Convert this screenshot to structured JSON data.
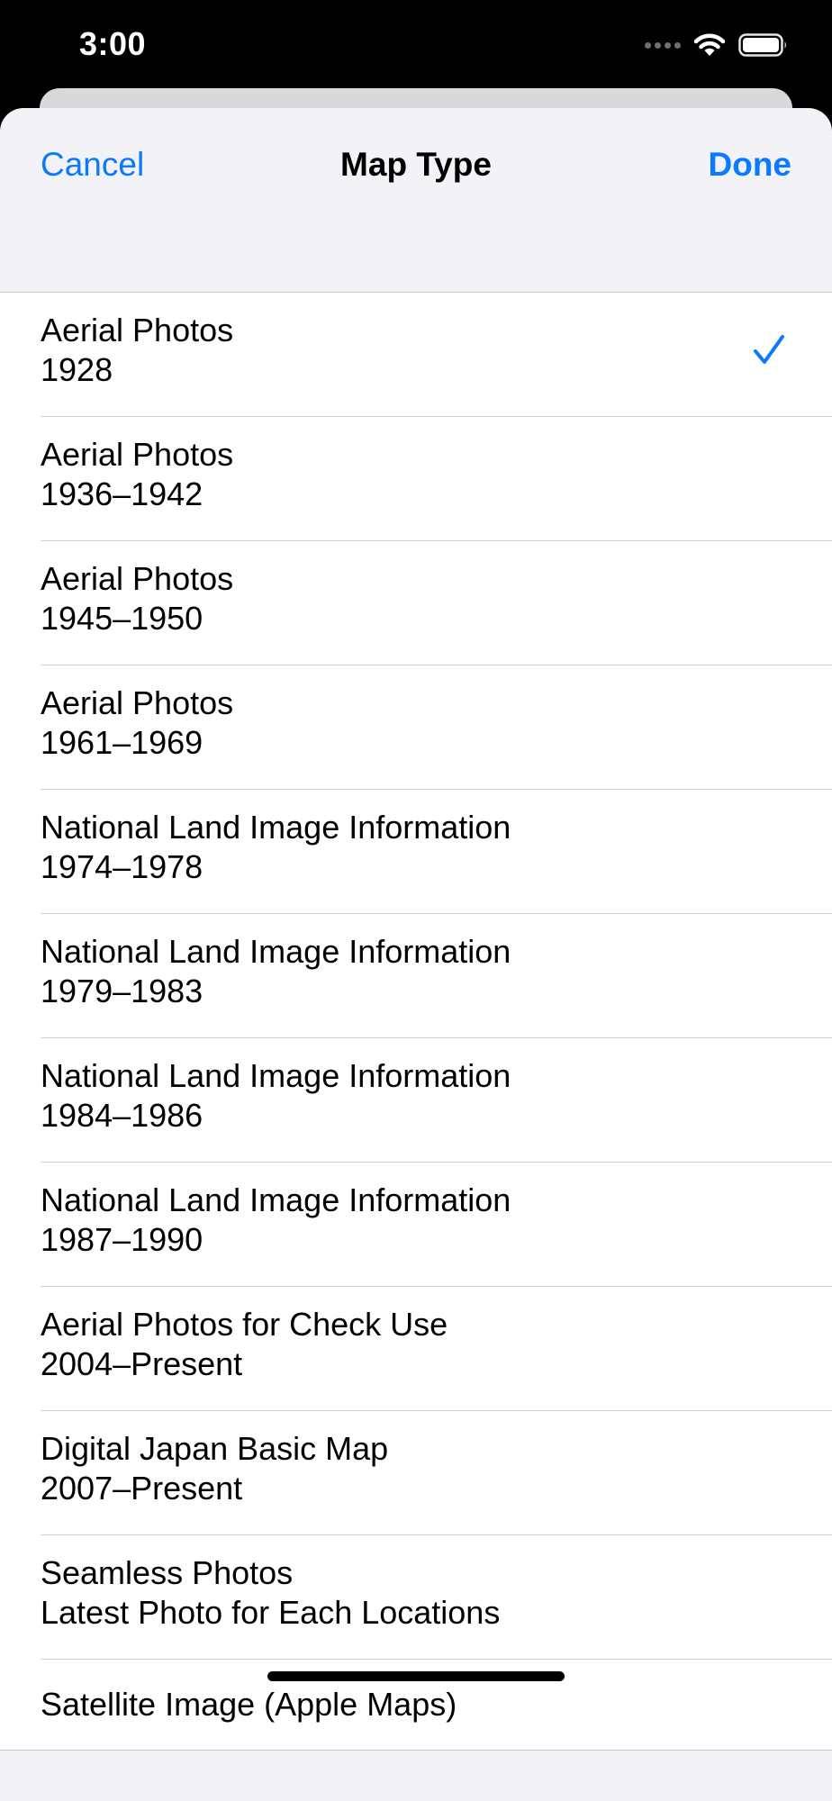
{
  "status_bar": {
    "time": "3:00"
  },
  "nav": {
    "cancel_label": "Cancel",
    "title": "Map Type",
    "done_label": "Done"
  },
  "accent_color": "#0a7aff",
  "items": [
    {
      "title": "Aerial Photos",
      "subtitle": "1928",
      "selected": true
    },
    {
      "title": "Aerial Photos",
      "subtitle": "1936–1942",
      "selected": false
    },
    {
      "title": "Aerial Photos",
      "subtitle": "1945–1950",
      "selected": false
    },
    {
      "title": "Aerial Photos",
      "subtitle": "1961–1969",
      "selected": false
    },
    {
      "title": "National Land Image Information",
      "subtitle": "1974–1978",
      "selected": false
    },
    {
      "title": "National Land Image Information",
      "subtitle": "1979–1983",
      "selected": false
    },
    {
      "title": "National Land Image Information",
      "subtitle": "1984–1986",
      "selected": false
    },
    {
      "title": "National Land Image Information",
      "subtitle": "1987–1990",
      "selected": false
    },
    {
      "title": "Aerial Photos for Check Use",
      "subtitle": "2004–Present",
      "selected": false
    },
    {
      "title": "Digital Japan Basic Map",
      "subtitle": "2007–Present",
      "selected": false
    },
    {
      "title": "Seamless Photos",
      "subtitle": "Latest Photo for Each Locations",
      "selected": false
    },
    {
      "title": "Satellite Image (Apple Maps)",
      "subtitle": "",
      "selected": false
    }
  ]
}
